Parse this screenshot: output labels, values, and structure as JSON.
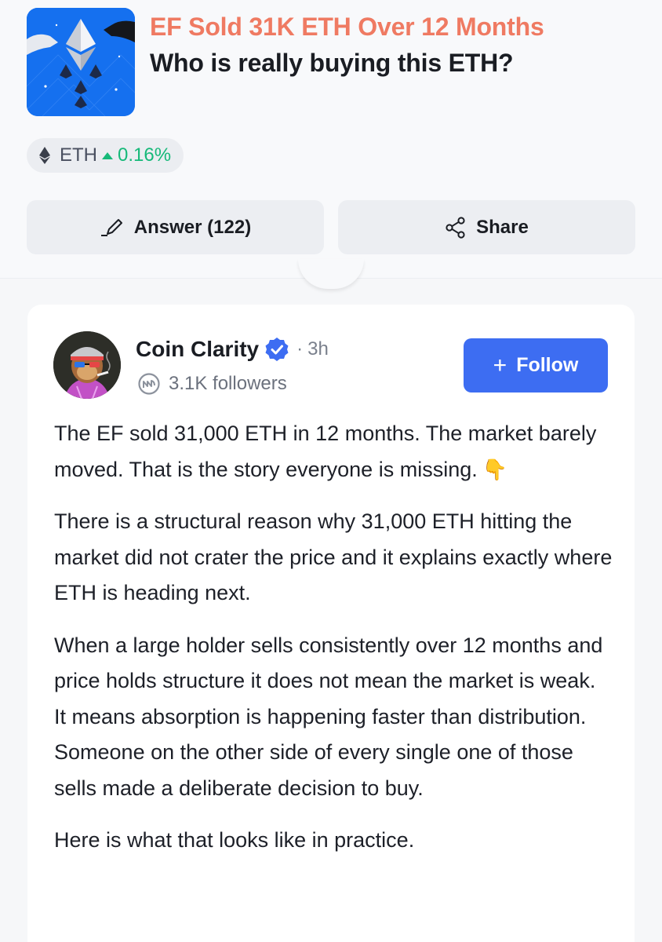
{
  "question": {
    "title": "EF Sold 31K ETH Over 12 Months",
    "subtitle": "Who is really buying this ETH?",
    "thumbnail_icon": "ethereum-hands-image"
  },
  "ticker": {
    "symbol": "ETH",
    "change": "0.16%",
    "direction": "up",
    "change_color": "#16b979"
  },
  "actions": {
    "answer_label": "Answer (122)",
    "share_label": "Share"
  },
  "post": {
    "author": "Coin Clarity",
    "separator": "·",
    "time": "3h",
    "followers": "3.1K followers",
    "follow_label": "Follow",
    "follow_color": "#3d6df2",
    "paragraphs": [
      "The EF sold 31,000 ETH in 12 months. The market barely moved. That is the story everyone is missing.",
      "There is a structural reason why 31,000 ETH hitting the market did not crater the price  and it explains exactly where ETH is heading next.",
      "When a large holder sells consistently over 12 months and price holds structure  it does not mean the market is weak. It means absorption is happening faster than distribution. Someone on the other side of every single one of those sells made a deliberate decision to buy.",
      "Here is what that looks like in practice."
    ],
    "emoji": "👇"
  }
}
